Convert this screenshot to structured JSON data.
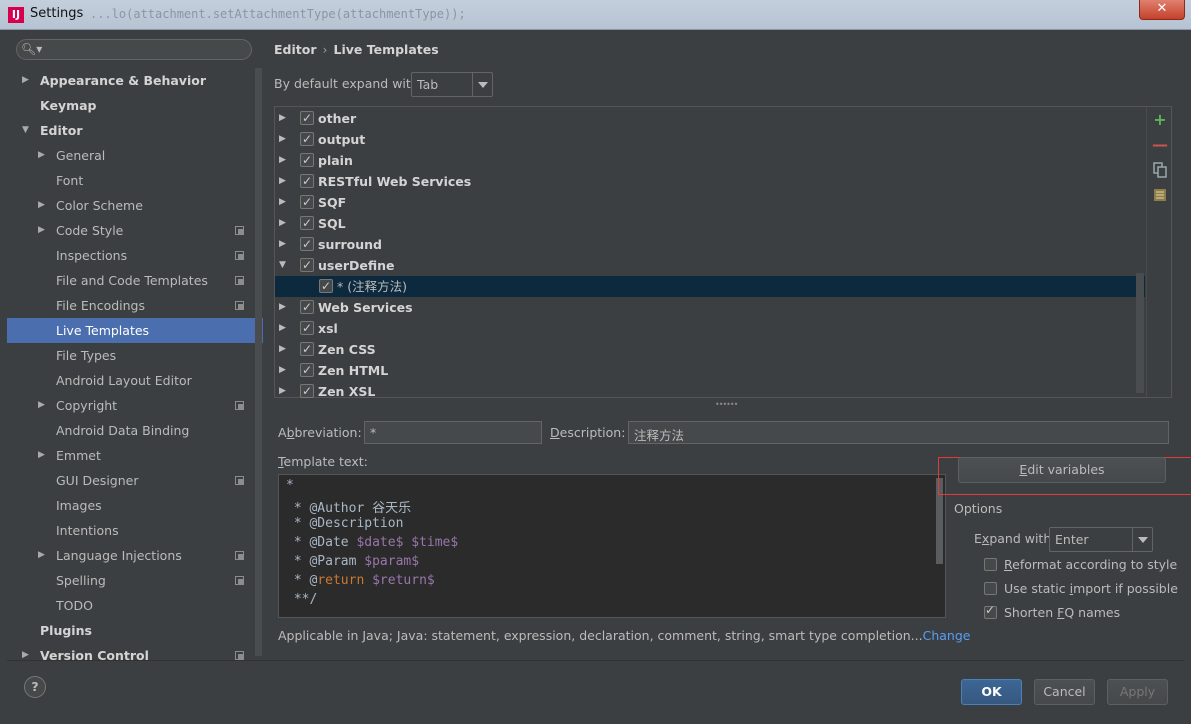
{
  "window": {
    "title": "Settings",
    "app_icon_letter": "IJ",
    "background_code_ghost": "                  ...lo(attachment.setAttachmentType(attachmentType));"
  },
  "sidebar": {
    "search_placeholder": "",
    "items": [
      {
        "label": "Appearance & Behavior",
        "level": 0,
        "arrow": "collapsed",
        "project": false,
        "selected": false
      },
      {
        "label": "Keymap",
        "level": 0,
        "arrow": "none",
        "project": false,
        "selected": false
      },
      {
        "label": "Editor",
        "level": 0,
        "arrow": "expanded",
        "project": false,
        "selected": false
      },
      {
        "label": "General",
        "level": 1,
        "arrow": "collapsed",
        "project": false,
        "selected": false
      },
      {
        "label": "Font",
        "level": 1,
        "arrow": "none",
        "project": false,
        "selected": false
      },
      {
        "label": "Color Scheme",
        "level": 1,
        "arrow": "collapsed",
        "project": false,
        "selected": false
      },
      {
        "label": "Code Style",
        "level": 1,
        "arrow": "collapsed",
        "project": true,
        "selected": false
      },
      {
        "label": "Inspections",
        "level": 1,
        "arrow": "none",
        "project": true,
        "selected": false
      },
      {
        "label": "File and Code Templates",
        "level": 1,
        "arrow": "none",
        "project": true,
        "selected": false
      },
      {
        "label": "File Encodings",
        "level": 1,
        "arrow": "none",
        "project": true,
        "selected": false
      },
      {
        "label": "Live Templates",
        "level": 1,
        "arrow": "none",
        "project": false,
        "selected": true
      },
      {
        "label": "File Types",
        "level": 1,
        "arrow": "none",
        "project": false,
        "selected": false
      },
      {
        "label": "Android Layout Editor",
        "level": 1,
        "arrow": "none",
        "project": false,
        "selected": false
      },
      {
        "label": "Copyright",
        "level": 1,
        "arrow": "collapsed",
        "project": true,
        "selected": false
      },
      {
        "label": "Android Data Binding",
        "level": 1,
        "arrow": "none",
        "project": false,
        "selected": false
      },
      {
        "label": "Emmet",
        "level": 1,
        "arrow": "collapsed",
        "project": false,
        "selected": false
      },
      {
        "label": "GUI Designer",
        "level": 1,
        "arrow": "none",
        "project": true,
        "selected": false
      },
      {
        "label": "Images",
        "level": 1,
        "arrow": "none",
        "project": false,
        "selected": false
      },
      {
        "label": "Intentions",
        "level": 1,
        "arrow": "none",
        "project": false,
        "selected": false
      },
      {
        "label": "Language Injections",
        "level": 1,
        "arrow": "collapsed",
        "project": true,
        "selected": false
      },
      {
        "label": "Spelling",
        "level": 1,
        "arrow": "none",
        "project": true,
        "selected": false
      },
      {
        "label": "TODO",
        "level": 1,
        "arrow": "none",
        "project": false,
        "selected": false
      },
      {
        "label": "Plugins",
        "level": 0,
        "arrow": "none",
        "project": false,
        "selected": false
      },
      {
        "label": "Version Control",
        "level": 0,
        "arrow": "collapsed",
        "project": true,
        "selected": false
      }
    ]
  },
  "breadcrumb": {
    "parent": "Editor",
    "separator": "›",
    "current": "Live Templates"
  },
  "expand_default": {
    "label": "By default expand with",
    "value": "Tab"
  },
  "template_groups": [
    {
      "name": "other",
      "checked": true,
      "expanded": false,
      "child": false,
      "selected": false
    },
    {
      "name": "output",
      "checked": true,
      "expanded": false,
      "child": false,
      "selected": false
    },
    {
      "name": "plain",
      "checked": true,
      "expanded": false,
      "child": false,
      "selected": false
    },
    {
      "name": "RESTful Web Services",
      "checked": true,
      "expanded": false,
      "child": false,
      "selected": false
    },
    {
      "name": "SQF",
      "checked": true,
      "expanded": false,
      "child": false,
      "selected": false
    },
    {
      "name": "SQL",
      "checked": true,
      "expanded": false,
      "child": false,
      "selected": false
    },
    {
      "name": "surround",
      "checked": true,
      "expanded": false,
      "child": false,
      "selected": false
    },
    {
      "name": "userDefine",
      "checked": true,
      "expanded": true,
      "child": false,
      "selected": false
    },
    {
      "name": "* (注释方法)",
      "checked": true,
      "expanded": false,
      "child": true,
      "selected": true
    },
    {
      "name": "Web Services",
      "checked": true,
      "expanded": false,
      "child": false,
      "selected": false
    },
    {
      "name": "xsl",
      "checked": true,
      "expanded": false,
      "child": false,
      "selected": false
    },
    {
      "name": "Zen CSS",
      "checked": true,
      "expanded": false,
      "child": false,
      "selected": false
    },
    {
      "name": "Zen HTML",
      "checked": true,
      "expanded": false,
      "child": false,
      "selected": false
    },
    {
      "name": "Zen XSL",
      "checked": true,
      "expanded": false,
      "child": false,
      "selected": false
    }
  ],
  "toolbar": {
    "add_icon": "plus-icon",
    "remove_icon": "minus-icon",
    "copy_icon": "copy-icon",
    "group_icon": "group-icon",
    "add_color": "#5ab55a",
    "remove_color": "#c75450"
  },
  "abbreviation": {
    "label_pre": "A",
    "label_mn": "b",
    "label_post": "breviation:",
    "value": "*"
  },
  "description": {
    "label_mn": "D",
    "label_post": "escription:",
    "value": "注释方法"
  },
  "template_text": {
    "label_mn": "T",
    "label_post": "emplate text:",
    "lines": [
      [
        {
          "t": "*",
          "c": "plain"
        }
      ],
      [
        {
          "t": " * @Author 谷天乐",
          "c": "plain"
        }
      ],
      [
        {
          "t": " * @Description",
          "c": "plain"
        }
      ],
      [
        {
          "t": " * @Date ",
          "c": "plain"
        },
        {
          "t": "$date$",
          "c": "var"
        },
        {
          "t": " ",
          "c": "plain"
        },
        {
          "t": "$time$",
          "c": "var"
        }
      ],
      [
        {
          "t": " * @Param ",
          "c": "plain"
        },
        {
          "t": "$param$",
          "c": "var"
        }
      ],
      [
        {
          "t": " * @",
          "c": "plain"
        },
        {
          "t": "return",
          "c": "kw"
        },
        {
          "t": " ",
          "c": "plain"
        },
        {
          "t": "$return$",
          "c": "var"
        }
      ],
      [
        {
          "t": " **/",
          "c": "plain"
        }
      ]
    ]
  },
  "edit_variables": {
    "mn": "E",
    "rest": "dit variables"
  },
  "options": {
    "title": "Options",
    "expand_with": {
      "label_pre": "E",
      "label_mn": "x",
      "label_post": "pand with",
      "value": "Enter"
    },
    "reformat": {
      "pre": "",
      "mn": "R",
      "post": "eformat according to style",
      "checked": false
    },
    "static_import": {
      "pre": "Use static ",
      "mn": "i",
      "post": "mport if possible",
      "checked": false
    },
    "shorten_fq": {
      "pre": "Shorten ",
      "mn": "F",
      "post": "Q names",
      "checked": true
    }
  },
  "applicable": {
    "text": "Applicable in Java; Java: statement, expression, declaration, comment, string, smart type completion...",
    "link": "Change"
  },
  "footer": {
    "help": "?",
    "ok": "OK",
    "cancel": "Cancel",
    "apply": "Apply"
  }
}
